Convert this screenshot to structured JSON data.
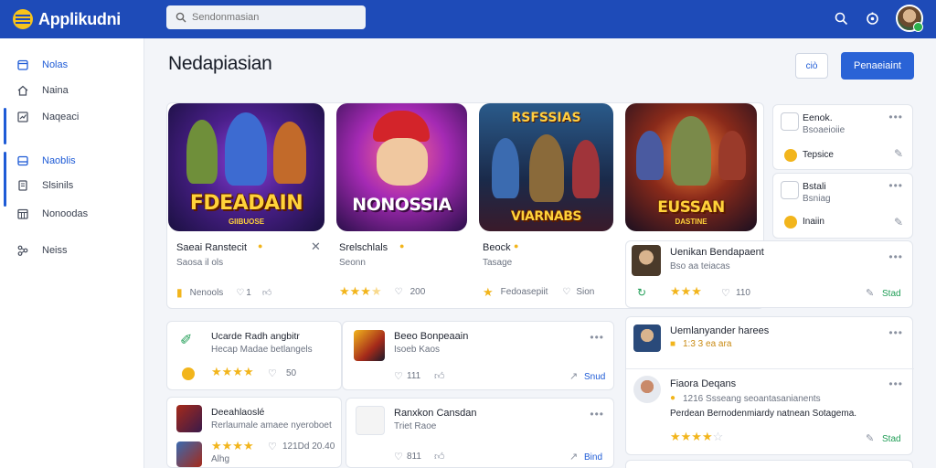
{
  "app": {
    "name": "Applikudni"
  },
  "search": {
    "placeholder": "Sendonmasian"
  },
  "sidebar": {
    "items": [
      {
        "label": "Nolas",
        "icon": "calendar-icon",
        "active": true
      },
      {
        "label": "Naina",
        "icon": "home-icon",
        "active": false
      },
      {
        "label": "Naqeaci",
        "icon": "chart-icon",
        "active": false
      },
      {
        "label": "Naoblis",
        "icon": "inbox-icon",
        "active": true
      },
      {
        "label": "Slsinils",
        "icon": "document-icon",
        "active": false
      },
      {
        "label": "Nonoodas",
        "icon": "grid-calendar-icon",
        "active": false
      },
      {
        "label": "Neiss",
        "icon": "network-icon",
        "active": false
      }
    ]
  },
  "header": {
    "title": "Nedapiasian",
    "secondary_button": "ciò",
    "primary_button": "Penaeiaint"
  },
  "featured": {
    "games": [
      {
        "tile_text": "FDEADAIN",
        "tile_sub": "GIIBUOSE",
        "name": "Saeai Ranstecit",
        "sub": "Saosa il ols",
        "row_label": "Nenools",
        "row_count": "1"
      },
      {
        "tile_text": "NONOSSIA",
        "tile_sub": "",
        "name": "Srelschlals",
        "sub": "Seonn",
        "rating": 4,
        "row_count": "200"
      },
      {
        "tile_text": "VIARNABS",
        "tile_sub": "RSFSSIAS",
        "name": "Beock",
        "sub": "Tasage",
        "row_label": "Fedoasepiit",
        "row_count": "Sion"
      },
      {
        "tile_text": "EUSSAN",
        "tile_sub": "DASTINE",
        "name": "",
        "sub": "",
        "rating": 3,
        "row_count": ""
      }
    ]
  },
  "right_cards": [
    {
      "title": "Eenok.",
      "sub": "Bsoaeioiie",
      "label": "Tepsice"
    },
    {
      "title": "Bstali",
      "sub": "Bsniag",
      "label": "Inaiin"
    }
  ],
  "wide_card": {
    "title": "Uenikan Bendapaent",
    "sub": "Bso aa teiacas",
    "rating": 3,
    "count": "110",
    "link": "Stad"
  },
  "list_cards": [
    {
      "title": "Ucarde Radh angbitr",
      "sub": "Hecap Madae betlangels",
      "rating": 4,
      "count": "50"
    },
    {
      "title": "Beeo Bonpeaain",
      "sub": "Isoeb Kaos",
      "count": "111",
      "link": "Snud"
    },
    {
      "title": "Deeahlaoslé",
      "sub": "Rerlaumale amaee nyeroboet",
      "sub2": "Alhg",
      "rating": 4,
      "count": "121Dd 20.40"
    },
    {
      "title": "Ranxkon Cansdan",
      "sub": "Triet Raoe",
      "count": "811",
      "link": "Bind"
    }
  ],
  "right_lists": [
    {
      "title": "Uemlanyander harees",
      "sub": "1:3 3 ea ara"
    },
    {
      "title": "Fiaora Deqans",
      "sub": "1216 Ssseang seoantasanianents",
      "desc": "Perdean Bernodenmiardy natnean Sotagema.",
      "rating": 4,
      "link": "Stad"
    }
  ],
  "colors": {
    "topbar": "#1e4bb8",
    "accent": "#2a63d6",
    "star": "#f2b51c"
  }
}
